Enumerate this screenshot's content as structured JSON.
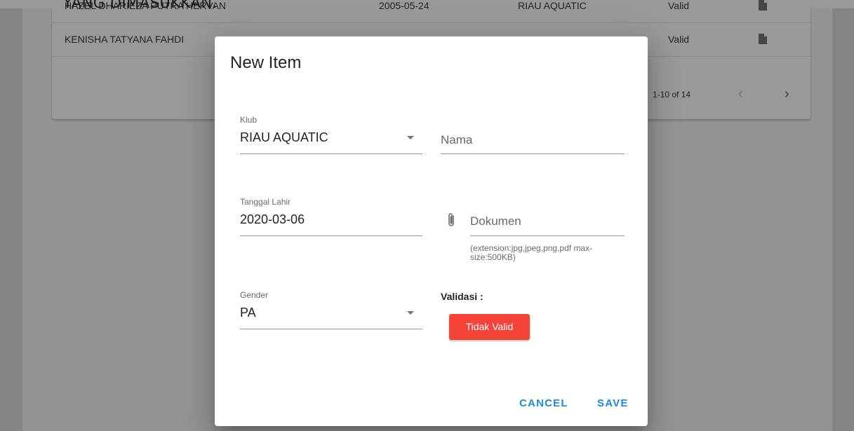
{
  "caption": "YANG DIMASUKKAN.",
  "table": {
    "rows": [
      {
        "name": "HAZEL DHARIEZA PUTRA HERVAN",
        "date": "2005-05-24",
        "club": "RIAU AQUATIC",
        "status": "Valid",
        "doc_icon": "file-icon"
      },
      {
        "name": "KENISHA TATYANA FAHDI",
        "date": "",
        "club": "",
        "status": "Valid",
        "doc_icon": "file-icon"
      }
    ],
    "footer": {
      "range": "1-10 of 14",
      "prev_icon": "chevron-left-icon",
      "next_icon": "chevron-right-icon"
    }
  },
  "dialog": {
    "title": "New Item",
    "klub": {
      "label": "Klub",
      "value": "RIAU AQUATIC"
    },
    "nama": {
      "placeholder": "Nama"
    },
    "tanggal_lahir": {
      "label": "Tanggal Lahir",
      "value": "2020-03-06"
    },
    "dokumen": {
      "placeholder": "Dokumen",
      "hint": "(extension:jpg,jpeg,png,pdf max-size:500KB)",
      "icon": "paperclip-icon"
    },
    "gender": {
      "label": "Gender",
      "value": "PA"
    },
    "validasi": {
      "label": "Validasi :",
      "badge": "Tidak Valid",
      "badge_color": "#f44336"
    },
    "actions": {
      "cancel": "CANCEL",
      "save": "SAVE",
      "accent": "#1e88e5"
    }
  }
}
